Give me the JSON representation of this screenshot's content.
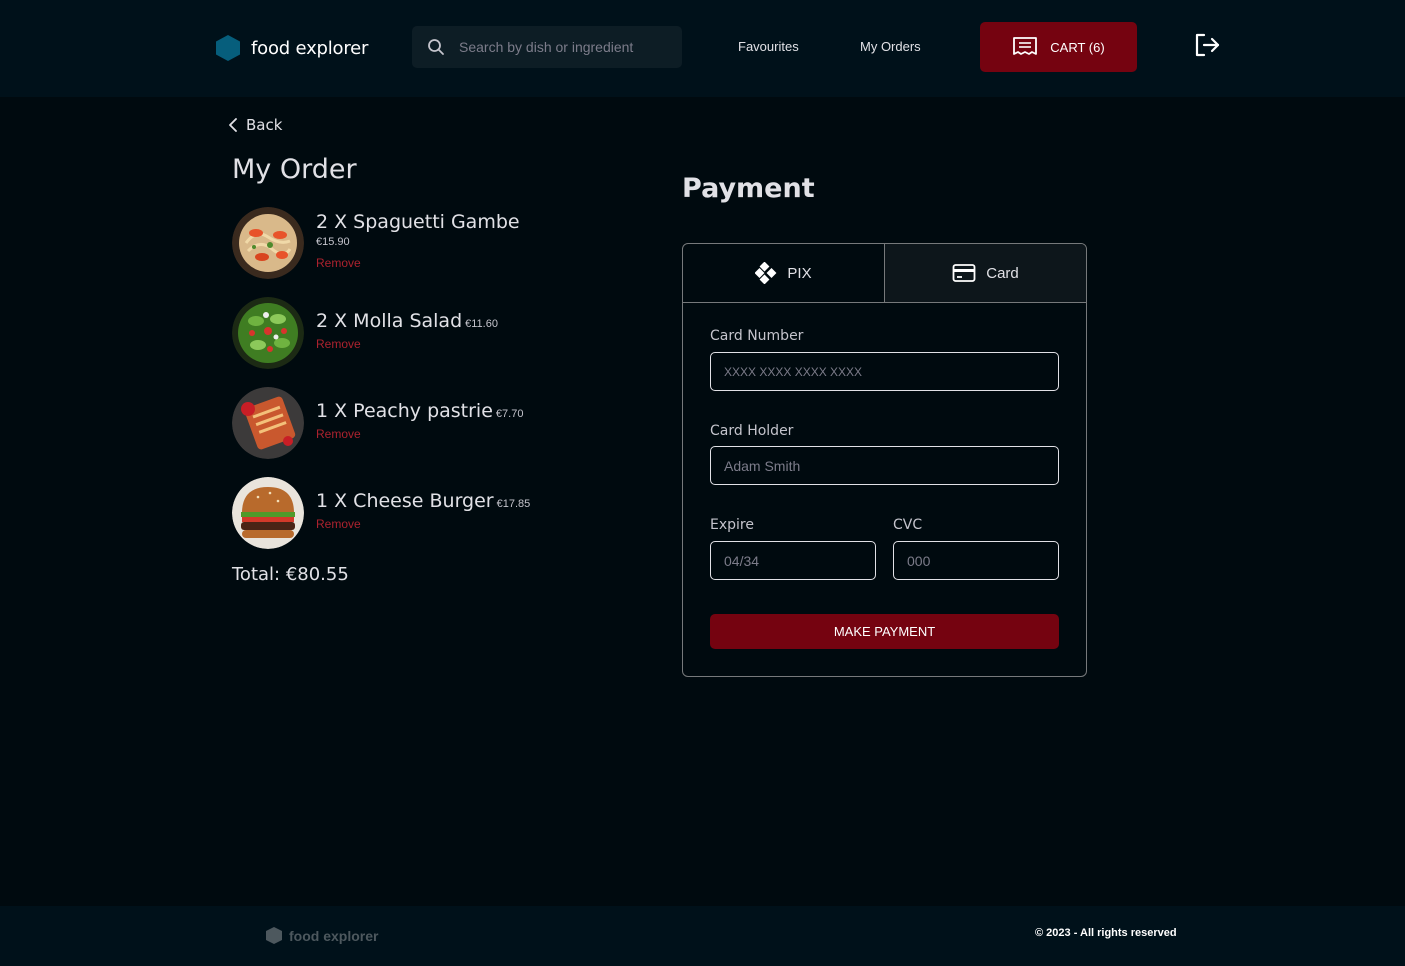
{
  "header": {
    "logo_text": "food explorer",
    "search_placeholder": "Search by dish or ingredient",
    "nav": {
      "favourites": "Favourites",
      "my_orders": "My Orders"
    },
    "cart_label": "CART (6)",
    "accent_color": "#750310"
  },
  "back_label": "Back",
  "order": {
    "title": "My Order",
    "items": [
      {
        "name": "2 X Spaguetti Gambe",
        "price": "€15.90",
        "remove": "Remove"
      },
      {
        "name": "2 X Molla Salad",
        "price": "€11.60",
        "remove": "Remove"
      },
      {
        "name": "1 X Peachy pastrie",
        "price": "€7.70",
        "remove": "Remove"
      },
      {
        "name": "1 X Cheese Burger",
        "price": "€17.85",
        "remove": "Remove"
      }
    ],
    "total": "Total: €80.55"
  },
  "payment": {
    "title": "Payment",
    "tabs": {
      "pix": "PIX",
      "card": "Card"
    },
    "card_number_label": "Card Number",
    "card_number_placeholder": "XXXX XXXX XXXX XXXX",
    "card_holder_label": "Card Holder",
    "card_holder_placeholder": "Adam Smith",
    "expire_label": "Expire",
    "expire_placeholder": "04/34",
    "cvc_label": "CVC",
    "cvc_placeholder": "000",
    "submit_label": "MAKE PAYMENT"
  },
  "footer": {
    "logo_text": "food explorer",
    "copyright": "© 2023 - All rights reserved"
  }
}
